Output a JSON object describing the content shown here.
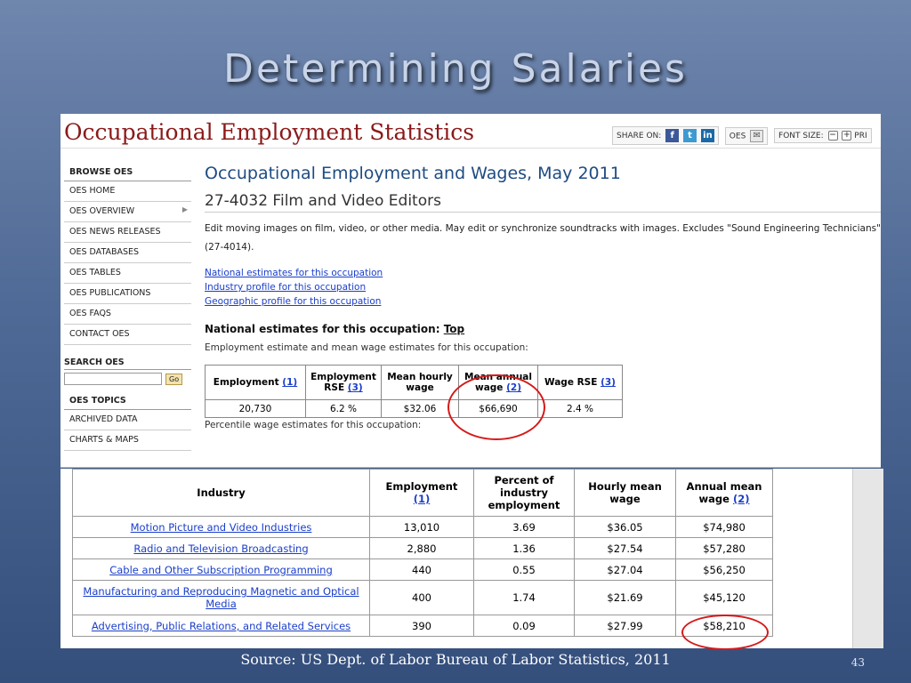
{
  "slide": {
    "title": "Determining Salaries",
    "source": "Source: US Dept. of Labor Bureau of Labor Statistics, 2011",
    "page_number": "43"
  },
  "header": {
    "title": "Occupational Employment Statistics",
    "share_label": "SHARE ON:",
    "oes_label": "OES",
    "font_size_label": "FONT SIZE:",
    "print_label": "PRI"
  },
  "sidebar": {
    "browse_heading": "BROWSE OES",
    "items": [
      {
        "label": "OES HOME"
      },
      {
        "label": "OES OVERVIEW"
      },
      {
        "label": "OES NEWS RELEASES"
      },
      {
        "label": "OES DATABASES"
      },
      {
        "label": "OES TABLES"
      },
      {
        "label": "OES PUBLICATIONS"
      },
      {
        "label": "OES FAQS"
      },
      {
        "label": "CONTACT OES"
      }
    ],
    "search_heading": "SEARCH OES",
    "search_button": "Go",
    "topics_heading": "OES TOPICS",
    "topics": [
      {
        "label": "ARCHIVED DATA"
      },
      {
        "label": "CHARTS & MAPS"
      }
    ]
  },
  "main": {
    "heading": "Occupational Employment and Wages, May 2011",
    "occupation": "27-4032 Film and Video Editors",
    "description": "Edit moving images on film, video, or other media. May edit or synchronize soundtracks with images. Excludes \"Sound Engineering Technicians\"(27-4014).",
    "links": [
      "National estimates for this occupation",
      "Industry profile for this occupation",
      "Geographic profile for this occupation"
    ],
    "national_heading": "National estimates for this occupation:",
    "top_link": "Top",
    "estimate_intro": "Employment estimate and mean wage estimates for this occupation:",
    "estimate_table": {
      "headers": [
        {
          "text": "Employment",
          "ref": "(1)"
        },
        {
          "text": "Employment RSE",
          "ref": "(3)"
        },
        {
          "text": "Mean hourly wage",
          "ref": ""
        },
        {
          "text": "Mean annual wage",
          "ref": "(2)"
        },
        {
          "text": "Wage RSE",
          "ref": "(3)"
        }
      ],
      "row": [
        "20,730",
        "6.2 %",
        "$32.06",
        "$66,690",
        "2.4 %"
      ]
    },
    "percentile_intro": "Percentile wage estimates for this occupation:"
  },
  "industry_table": {
    "headers": {
      "industry": "Industry",
      "employment": "Employment",
      "employment_ref": "(1)",
      "percent": "Percent of industry employment",
      "hourly": "Hourly mean wage",
      "annual": "Annual mean wage",
      "annual_ref": "(2)"
    },
    "rows": [
      {
        "industry": "Motion Picture and Video Industries",
        "employment": "13,010",
        "percent": "3.69",
        "hourly": "$36.05",
        "annual": "$74,980"
      },
      {
        "industry": "Radio and Television Broadcasting",
        "employment": "2,880",
        "percent": "1.36",
        "hourly": "$27.54",
        "annual": "$57,280"
      },
      {
        "industry": "Cable and Other Subscription Programming",
        "employment": "440",
        "percent": "0.55",
        "hourly": "$27.04",
        "annual": "$56,250"
      },
      {
        "industry": "Manufacturing and Reproducing Magnetic and Optical Media",
        "employment": "400",
        "percent": "1.74",
        "hourly": "$21.69",
        "annual": "$45,120"
      },
      {
        "industry": "Advertising, Public Relations, and Related Services",
        "employment": "390",
        "percent": "0.09",
        "hourly": "$27.99",
        "annual": "$58,210"
      }
    ]
  },
  "colors": {
    "highlight_circle": "#d51a1a",
    "link": "#1a3ec9",
    "oes_title": "#8b1a1a"
  }
}
